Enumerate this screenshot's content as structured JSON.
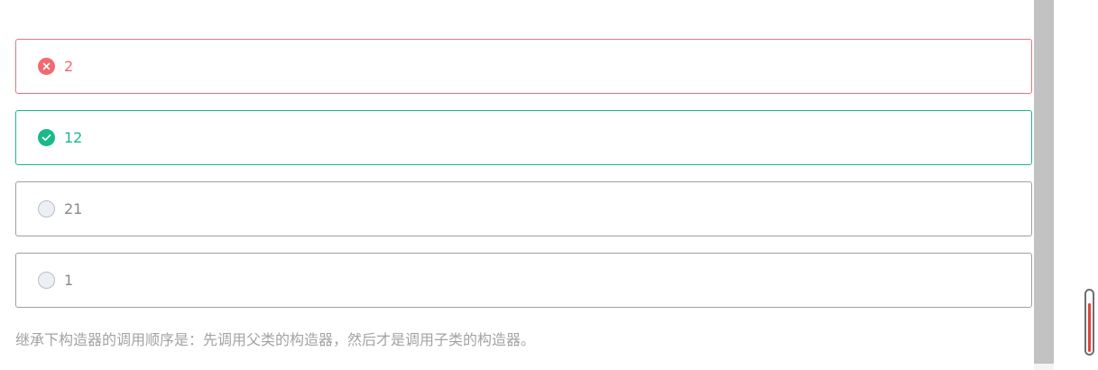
{
  "question": {
    "options": [
      {
        "label": "2",
        "status": "wrong"
      },
      {
        "label": "12",
        "status": "correct"
      },
      {
        "label": "21",
        "status": "neutral"
      },
      {
        "label": "1",
        "status": "neutral"
      }
    ],
    "explanation": "继承下构造器的调用顺序是：先调用父类的构造器，然后才是调用子类的构造器。"
  },
  "colors": {
    "wrong": "#f16a6f",
    "correct": "#19b98b",
    "neutral_border": "#a0a0a0",
    "explanation_text": "#a3a3a3",
    "indicator_fill": "#e0423c"
  },
  "icons": {
    "wrong": "x-circle-icon",
    "correct": "check-circle-icon",
    "neutral": "radio-empty-icon"
  },
  "indicator": {
    "level": 0.82
  }
}
